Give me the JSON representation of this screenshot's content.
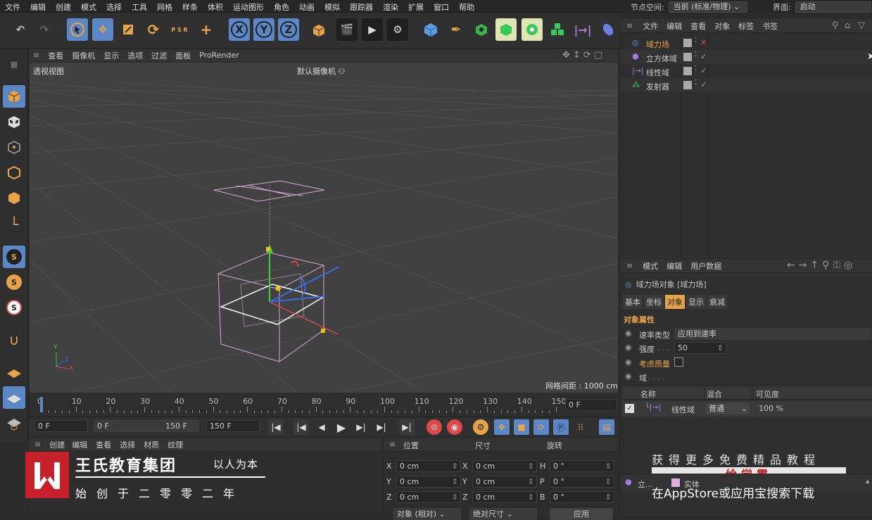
{
  "menubar": {
    "items": [
      "文件",
      "编辑",
      "创建",
      "模式",
      "选择",
      "工具",
      "网格",
      "样条",
      "体积",
      "运动图形",
      "角色",
      "动画",
      "模拟",
      "跟踪器",
      "渲染",
      "扩展",
      "窗口",
      "帮助"
    ],
    "node_space_label": "节点空间:",
    "node_space_value": "当前 (标准/物理)",
    "interface_label": "界面:",
    "interface_value": "启动"
  },
  "toolbar": {
    "axis_x": "X",
    "axis_y": "Y",
    "axis_z": "Z",
    "psr": "P S R",
    "icons": [
      "undo-icon",
      "redo-icon",
      "select-icon",
      "move-icon",
      "scale-icon",
      "rotate-icon",
      "psr-icon",
      "axis-icon",
      "lock-x-icon",
      "lock-y-icon",
      "lock-z-icon",
      "coordinate-system-icon",
      "render-region-icon",
      "render-view-icon",
      "render-settings-icon",
      "cube-icon",
      "pen-icon",
      "subdivision-icon",
      "deformer-icon",
      "cloner-icon",
      "array-icon",
      "field-icon",
      "volume-icon"
    ]
  },
  "viewport": {
    "menu": [
      "查看",
      "摄像机",
      "显示",
      "选项",
      "过滤",
      "面板",
      "ProRender"
    ],
    "view_label": "透视视图",
    "camera_label": "默认摄像机",
    "grid_spacing": "网格间距 : 1000 cm",
    "axis_x": "X",
    "axis_y": "Y",
    "axis_z": "Z"
  },
  "timeline": {
    "ticks": [
      "0",
      "10",
      "20",
      "30",
      "40",
      "50",
      "60",
      "70",
      "80",
      "90",
      "100",
      "110",
      "120",
      "130",
      "140",
      "150"
    ],
    "current_frame": "0 F",
    "start_field": "0 F",
    "range_start": "0 F",
    "range_end": "150 F",
    "end_field": "150 F"
  },
  "material_panel": {
    "menu": [
      "创建",
      "编辑",
      "查看",
      "选择",
      "材质",
      "纹理"
    ]
  },
  "watermark_left": {
    "title": "王氏教育集团",
    "slogan": "以人为本",
    "subtitle": "始创于二零零二年"
  },
  "coordinates": {
    "headers": [
      "位置",
      "尺寸",
      "旋转"
    ],
    "rows": [
      {
        "pos_label": "X",
        "pos": "0 cm",
        "size_label": "X",
        "size": "0 cm",
        "rot_label": "H",
        "rot": "0 °"
      },
      {
        "pos_label": "Y",
        "pos": "0 cm",
        "size_label": "Y",
        "size": "0 cm",
        "rot_label": "P",
        "rot": "0 °"
      },
      {
        "pos_label": "Z",
        "pos": "0 cm",
        "size_label": "Z",
        "size": "0 cm",
        "rot_label": "B",
        "rot": "0 °"
      }
    ],
    "mode": "对象 (相对)",
    "size_mode": "绝对尺寸",
    "apply": "应用"
  },
  "object_manager": {
    "menu": [
      "文件",
      "编辑",
      "查看",
      "对象",
      "标签",
      "书签"
    ],
    "objects": [
      {
        "name": "域力场",
        "selected": true,
        "status": "cross"
      },
      {
        "name": "立方体域",
        "selected": false,
        "status": "check"
      },
      {
        "name": "线性域",
        "selected": false,
        "status": "check"
      },
      {
        "name": "发射器",
        "selected": false,
        "status": "check"
      }
    ]
  },
  "attribute_manager": {
    "menu": [
      "模式",
      "编辑",
      "用户数据"
    ],
    "object_title": "域力场对象 [域力场]",
    "tabs": [
      "基本",
      "坐标",
      "对象",
      "显示",
      "衰减"
    ],
    "active_tab": "对象",
    "section_title": "对象属性",
    "props": {
      "speed_type_label": "速率类型",
      "speed_type_value": "应用到速率",
      "strength_label": "强度",
      "strength_value": "50",
      "consider_mass_label": "考虑质量",
      "field_label": "域"
    },
    "field_table": {
      "headers": [
        "名称",
        "混合",
        "可见度"
      ],
      "row": {
        "name": "线性域",
        "blend": "普通",
        "visibility": "100 %"
      }
    }
  },
  "bottom_bar": {
    "item": "立...",
    "tag": "实体"
  },
  "watermark_right": {
    "line1": "获得更多免费精品教程",
    "brand": "绘学霸",
    "line2": "在AppStore或应用宝搜索下载"
  },
  "colors": {
    "accent": "#e8a34a",
    "selected_blue": "#5b87c6",
    "viewport_bg": "#414141",
    "check_green": "#5fd35f",
    "cross_red": "#e04848"
  }
}
